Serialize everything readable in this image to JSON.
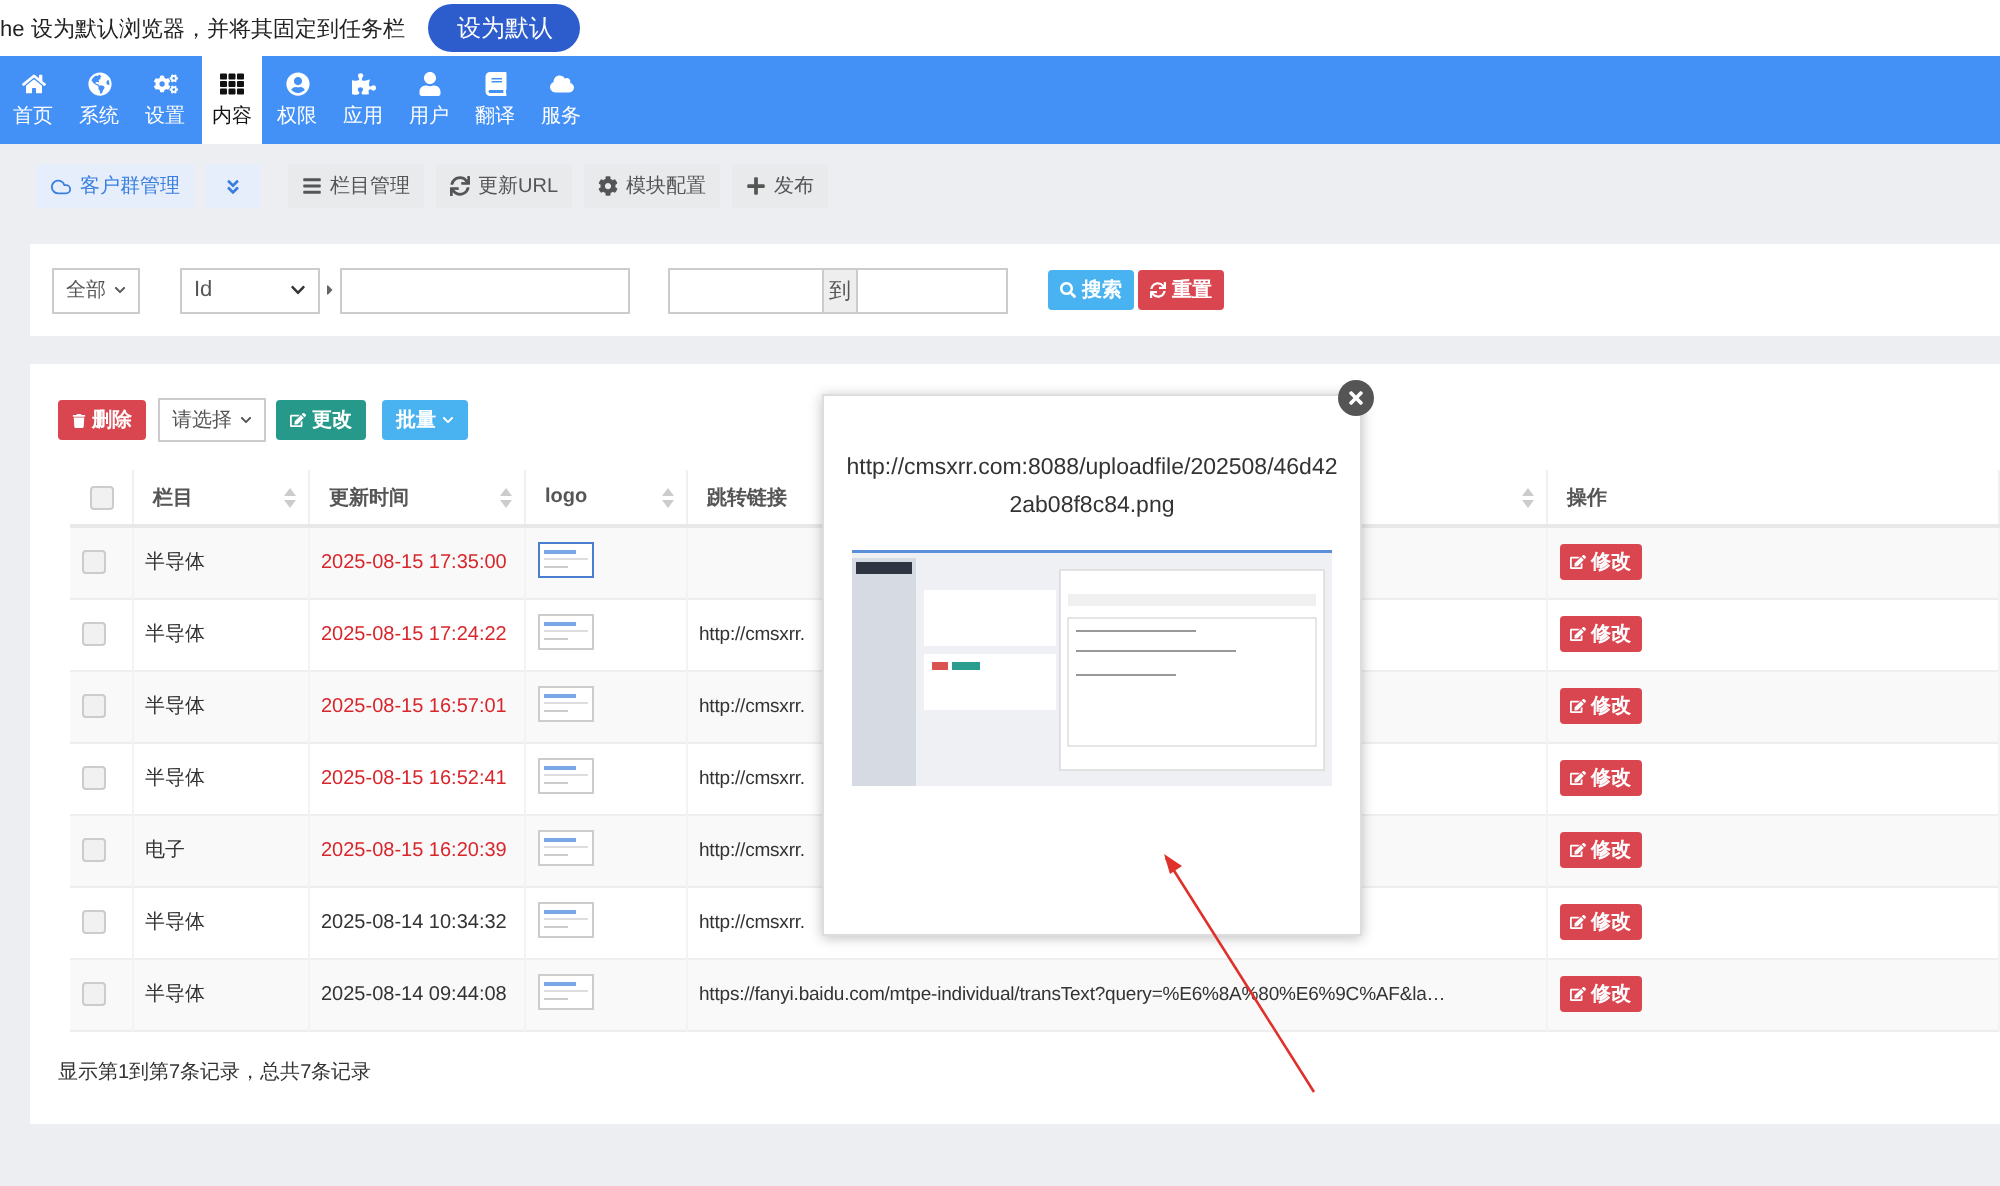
{
  "browser_bar": {
    "message": "he 设为默认浏览器，并将其固定到任务栏",
    "button": "设为默认"
  },
  "nav": [
    {
      "label": "首页",
      "selected": false
    },
    {
      "label": "系统",
      "selected": false
    },
    {
      "label": "设置",
      "selected": false
    },
    {
      "label": "内容",
      "selected": true
    },
    {
      "label": "权限",
      "selected": false
    },
    {
      "label": "应用",
      "selected": false
    },
    {
      "label": "用户",
      "selected": false
    },
    {
      "label": "翻译",
      "selected": false
    },
    {
      "label": "服务",
      "selected": false
    }
  ],
  "toolbar": [
    {
      "kind": "tab",
      "label": "客户群管理",
      "selected": true
    },
    {
      "kind": "toggle"
    },
    {
      "kind": "button",
      "label": "栏目管理"
    },
    {
      "kind": "button",
      "label": "更新URL"
    },
    {
      "kind": "button",
      "label": "模块配置"
    },
    {
      "kind": "button",
      "label": "发布"
    }
  ],
  "search": {
    "scope": "全部",
    "field": "Id",
    "range_separator": "到",
    "search_button": "搜索",
    "reset_button": "重置"
  },
  "actions": {
    "delete": "删除",
    "select_placeholder": "请选择",
    "change": "更改",
    "batch": "批量"
  },
  "table": {
    "select_all_checked": false,
    "columns": [
      {
        "label": "栏目",
        "sortable": true
      },
      {
        "label": "更新时间",
        "sortable": true
      },
      {
        "label": "logo",
        "sortable": true
      },
      {
        "label": "跳转链接",
        "sortable": true
      },
      {
        "label": "操作",
        "sortable": false
      }
    ],
    "rows": [
      {
        "checked": false,
        "category": "半导体",
        "time": "2025-08-15 17:35:00",
        "recent": true,
        "logo_highlighted": true,
        "action": "修改"
      },
      {
        "checked": false,
        "category": "半导体",
        "time": "2025-08-15 17:24:22",
        "recent": true,
        "logo_highlighted": false,
        "link": "http://cmsxrr.",
        "action": "修改"
      },
      {
        "checked": false,
        "category": "半导体",
        "time": "2025-08-15 16:57:01",
        "recent": true,
        "logo_highlighted": false,
        "link": "http://cmsxrr.",
        "action": "修改"
      },
      {
        "checked": false,
        "category": "半导体",
        "time": "2025-08-15 16:52:41",
        "recent": true,
        "logo_highlighted": false,
        "link": "http://cmsxrr.",
        "action": "修改"
      },
      {
        "checked": false,
        "category": "电子",
        "time": "2025-08-15 16:20:39",
        "recent": true,
        "logo_highlighted": false,
        "link": "http://cmsxrr.",
        "action": "修改"
      },
      {
        "checked": false,
        "category": "半导体",
        "time": "2025-08-14 10:34:32",
        "recent": false,
        "logo_highlighted": false,
        "link": "http://cmsxrr.",
        "action": "修改"
      },
      {
        "checked": false,
        "category": "半导体",
        "time": "2025-08-14 09:44:08",
        "recent": false,
        "logo_highlighted": false,
        "link": "https://fanyi.baidu.com/mtpe-individual/transText?query=%E6%8A%80%E6%9C%AF&la…",
        "action": "修改"
      }
    ],
    "footer": "显示第1到第7条记录，总共7条记录"
  },
  "preview": {
    "url": "http://cmsxrr.com:8088/uploadfile/202508/46d422ab08f8c84.png"
  }
}
